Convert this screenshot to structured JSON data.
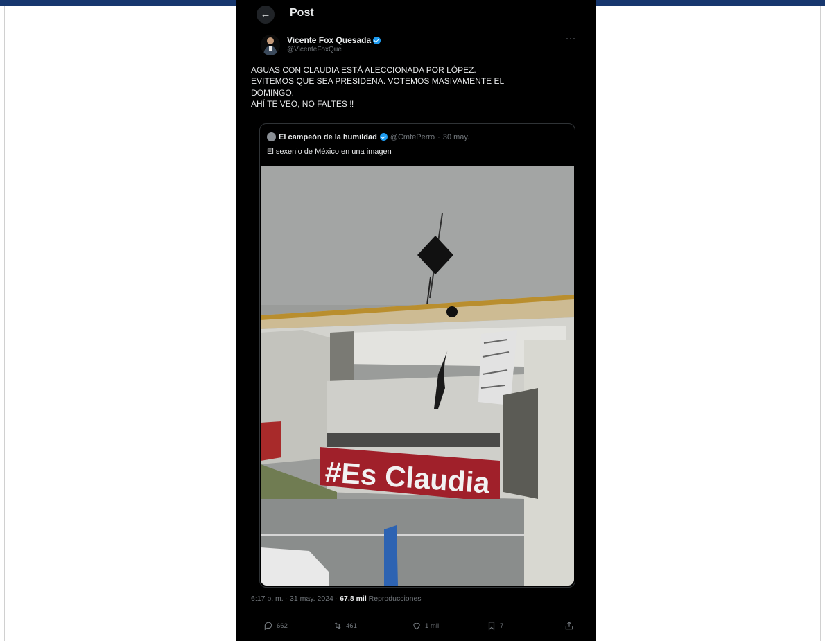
{
  "header": {
    "back_icon": "arrow-left-icon",
    "title": "Post"
  },
  "tweet": {
    "author_name": "Vicente Fox Quesada",
    "author_handle": "@VicenteFoxQue",
    "more_label": "···",
    "text_lines": [
      "AGUAS CON CLAUDIA ESTÁ ALECCIONADA POR LÓPEZ.",
      "EVITEMOS QUE SEA PRESIDENA. VOTEMOS MASIVAMENTE EL",
      "DOMINGO.",
      "AHÍ TE VEO, NO FALTES ‼"
    ],
    "quote": {
      "author_name": "El campeón de la humildad",
      "author_handle": "@CmtePerro",
      "separator": "·",
      "date": "30 may.",
      "text": "El sexenio de México en una imagen",
      "billboard_text": "#Es Claudia"
    },
    "timestamp": "6:17 p. m. · 31 may. 2024 ·",
    "views_count": "67,8 mil",
    "views_label": "Reproducciones",
    "replies": "662",
    "reposts": "461",
    "likes": "1 mil",
    "bookmarks": "7"
  },
  "colors": {
    "background": "#000000",
    "text": "#e7e9ea",
    "muted": "#71767b",
    "verified": "#1d9bf0",
    "window_bar": "#17376e"
  }
}
